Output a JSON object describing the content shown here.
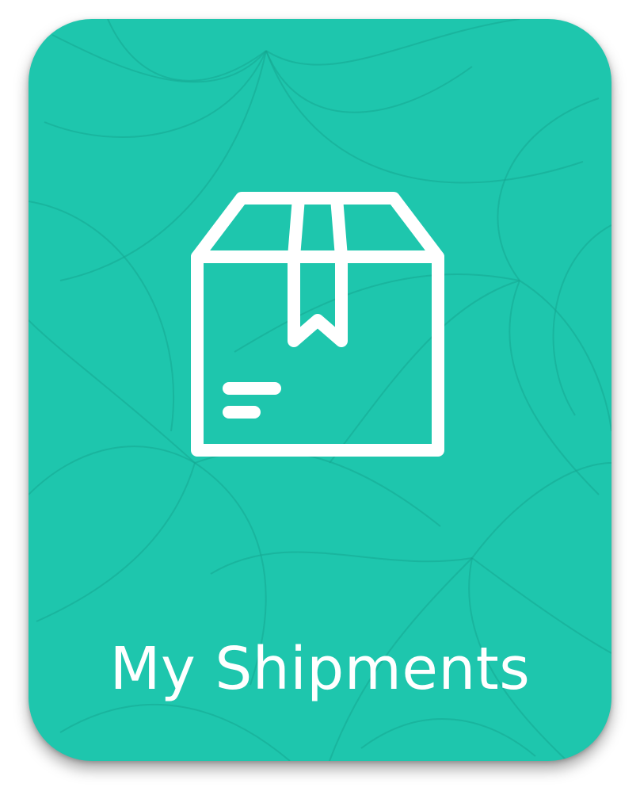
{
  "tile": {
    "title": "My Shipments",
    "icon": "package-box-icon",
    "background_color": "#1ec6ad",
    "pattern_color": "#16a792",
    "foreground_color": "#ffffff"
  }
}
